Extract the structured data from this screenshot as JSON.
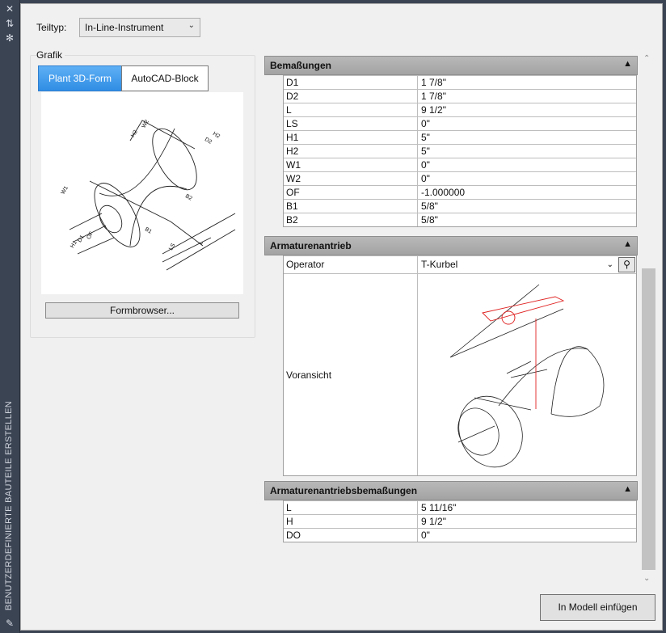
{
  "sidebar": {
    "title": "BENUTZERDEFINIERTE BAUTEILE ERSTELLEN"
  },
  "teiltyp": {
    "label": "Teiltyp:",
    "value": "In-Line-Instrument"
  },
  "grafik": {
    "label": "Grafik",
    "tabs": [
      {
        "label": "Plant 3D-Form",
        "active": true
      },
      {
        "label": "AutoCAD-Block",
        "active": false
      }
    ],
    "diagram_labels": [
      "H2",
      "W2",
      "D2",
      "H2",
      "B2",
      "W1",
      "H1",
      "D1",
      "OF",
      "B1",
      "LS",
      "L"
    ],
    "formbrowser_label": "Formbrowser..."
  },
  "sections": {
    "bemassungen": {
      "title": "Bemaßungen",
      "rows": [
        {
          "key": "D1",
          "value": "1 7/8\""
        },
        {
          "key": "D2",
          "value": "1 7/8\""
        },
        {
          "key": "L",
          "value": "9 1/2\""
        },
        {
          "key": "LS",
          "value": "0\""
        },
        {
          "key": "H1",
          "value": "5\""
        },
        {
          "key": "H2",
          "value": "5\""
        },
        {
          "key": "W1",
          "value": "0\""
        },
        {
          "key": "W2",
          "value": "0\""
        },
        {
          "key": "OF",
          "value": "-1.000000"
        },
        {
          "key": "B1",
          "value": "5/8\""
        },
        {
          "key": "B2",
          "value": "5/8\""
        }
      ]
    },
    "armaturenantrieb": {
      "title": "Armaturenantrieb",
      "operator_label": "Operator",
      "operator_value": "T-Kurbel",
      "voransicht_label": "Voransicht"
    },
    "antriebsbemassungen": {
      "title": "Armaturenantriebsbemaßungen",
      "rows": [
        {
          "key": "L",
          "value": "5 11/16\""
        },
        {
          "key": "H",
          "value": "9 1/2\""
        },
        {
          "key": "DO",
          "value": "0\""
        }
      ]
    }
  },
  "actions": {
    "insert_label": "In Modell einfügen"
  },
  "colors": {
    "active_tab": "#2f8de4",
    "section_header": "#ababab",
    "preview_highlight": "#e02020"
  }
}
